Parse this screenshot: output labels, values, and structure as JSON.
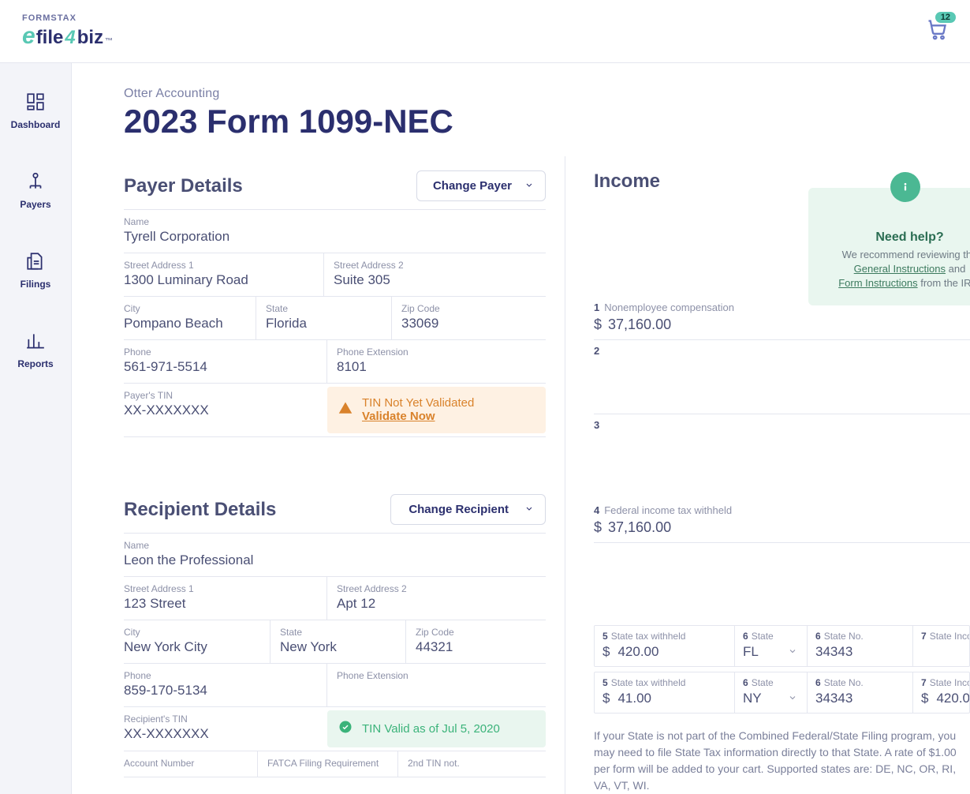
{
  "top": {
    "logoTop": "FORMSTAX",
    "cartCount": "12"
  },
  "sidebar": {
    "items": [
      {
        "label": "Dashboard"
      },
      {
        "label": "Payers"
      },
      {
        "label": "Filings"
      },
      {
        "label": "Reports"
      }
    ]
  },
  "header": {
    "company": "Otter Accounting",
    "title": "2023 Form 1099-NEC"
  },
  "payer": {
    "sectionTitle": "Payer Details",
    "changeBtn": "Change Payer",
    "nameLabel": "Name",
    "name": "Tyrell Corporation",
    "addr1Label": "Street Address 1",
    "addr1": "1300 Luminary Road",
    "addr2Label": "Street Address 2",
    "addr2": "Suite 305",
    "cityLabel": "City",
    "city": "Pompano Beach",
    "stateLabel": "State",
    "state": "Florida",
    "zipLabel": "Zip Code",
    "zip": "33069",
    "phoneLabel": "Phone",
    "phone": "561-971-5514",
    "extLabel": "Phone Extension",
    "ext": "8101",
    "tinLabel": "Payer's TIN",
    "tin": "XX-XXXXXXX",
    "tinWarn": "TIN Not Yet Validated",
    "validateNow": "Validate Now"
  },
  "recipient": {
    "sectionTitle": "Recipient Details",
    "changeBtn": "Change Recipient",
    "nameLabel": "Name",
    "name": "Leon the Professional",
    "addr1Label": "Street Address 1",
    "addr1": "123 Street",
    "addr2Label": "Street Address 2",
    "addr2": "Apt 12",
    "cityLabel": "City",
    "city": "New York City",
    "stateLabel": "State",
    "state": "New York",
    "zipLabel": "Zip Code",
    "zip": "44321",
    "phoneLabel": "Phone",
    "phone": "859-170-5134",
    "extLabel": "Phone Extension",
    "ext": "",
    "tinLabel": "Recipient's TIN",
    "tin": "XX-XXXXXXX",
    "tinValid": "TIN Valid as of Jul 5, 2020",
    "acctLabel": "Account Number",
    "fatcaLabel": "FATCA Filing Requirement",
    "secondTinLabel": "2nd TIN not."
  },
  "income": {
    "title": "Income",
    "help": {
      "heading": "Need help?",
      "text1": "We recommend reviewing the ",
      "link1": "General Instructions",
      "text2": " and ",
      "link2": "Form Instructions",
      "text3": " from the IRS."
    },
    "boxes": [
      {
        "num": "1",
        "label": "Nonemployee compensation",
        "value": "37,160.00"
      },
      {
        "num": "2",
        "label": "",
        "value": ""
      },
      {
        "num": "3",
        "label": "",
        "value": ""
      },
      {
        "num": "4",
        "label": "Federal income tax withheld",
        "value": "37,160.00"
      }
    ],
    "stateRows": [
      {
        "b5": "420.00",
        "b6": "FL",
        "b7": "34343",
        "b7i": ""
      },
      {
        "b5": "41.00",
        "b6": "NY",
        "b7": "34343",
        "b7i": "420.0"
      }
    ],
    "stateHdr": {
      "b5n": "5",
      "b5l": "State tax withheld",
      "b6n": "6",
      "b6l": "State",
      "b7n": "6",
      "b7l": "State No.",
      "b7in": "7",
      "b7il": "State Income"
    },
    "footnote": "If your State is not part of the Combined Federal/State Filing program, you may need to file State Tax information directly to that State. A rate of $1.00 per form will be added to your cart. Supported states are: DE, NC, OR, RI, VA, VT, WI."
  }
}
